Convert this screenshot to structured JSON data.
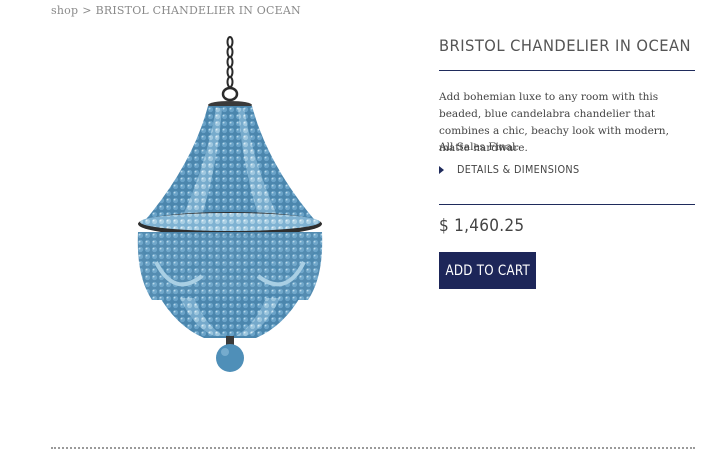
{
  "breadcrumb": {
    "root": "shop",
    "separator": ">",
    "current": "BRISTOL CHANDELIER IN OCEAN"
  },
  "product": {
    "title": "BRISTOL CHANDELIER IN OCEAN",
    "description": "Add bohemian luxe to any room with this beaded, blue candelabra chandelier that combines a chic, beachy look with modern, matte hardware.",
    "sales_note": "All Sales Final.",
    "details_label": "DETAILS & DIMENSIONS",
    "price": "$ 1,460.25",
    "add_to_cart_label": "ADD TO CART"
  },
  "colors": {
    "brand_navy": "#1d2659",
    "bead_blue": "#4f8fb8",
    "bead_light": "#9ec6dd"
  },
  "icons": {
    "details_toggle": "triangle-right-icon"
  }
}
